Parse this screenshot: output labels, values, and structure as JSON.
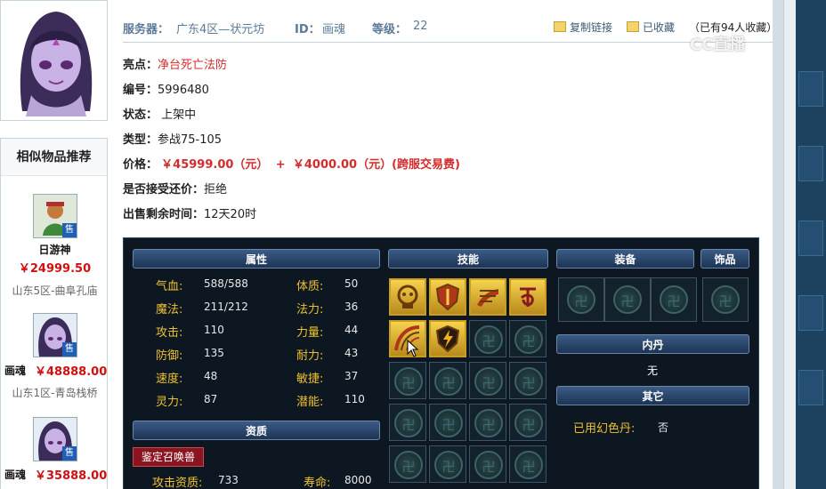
{
  "header": {
    "server_label": "服务器：",
    "server_value": "广东4区—状元坊",
    "id_label": "ID：",
    "id_value": "画魂",
    "level_label": "等级：",
    "level_value": "22",
    "copy_link": "复制链接",
    "favorited": "已收藏",
    "collect_count": "（已有94人收藏）"
  },
  "info": {
    "highlight_key": "亮点：",
    "highlight_val": "净台死亡法防",
    "serial_key": "编号：",
    "serial_val": "5996480",
    "status_key": "状态：",
    "status_val": "上架中",
    "type_key": "类型：",
    "type_val": "参战75-105",
    "price_key": "价格：",
    "price_val": "￥45999.00（元）",
    "plus": "+",
    "fee_val": "￥4000.00（元）(跨服交易费)",
    "counter_key": "是否接受还价：",
    "counter_val": "拒绝",
    "remain_key": "出售剩余时间：",
    "remain_val": "12天20时"
  },
  "recommend": {
    "title": "相似物品推荐",
    "sold_tag": "售",
    "items": [
      {
        "name": "日游神",
        "price": "￥24999.50",
        "server": "山东5区-曲阜孔庙",
        "icon": "day-wanderer-icon"
      },
      {
        "name": "画魂",
        "price": "￥48888.00",
        "server": "山东1区-青岛栈桥",
        "icon": "hua-hun-icon"
      },
      {
        "name": "画魂",
        "price": "￥35888.00",
        "server": "",
        "icon": "hua-hun-icon"
      }
    ]
  },
  "game": {
    "attr_title": "属性",
    "skill_title": "技能",
    "equip_title": "装备",
    "accessory_title": "饰品",
    "neidan_title": "内丹",
    "neidan_val": "无",
    "other_title": "其它",
    "qual_title": "资质",
    "appraise_btn": "鉴定召唤兽",
    "attrs_left": [
      {
        "k": "气血:",
        "v": "588/588"
      },
      {
        "k": "魔法:",
        "v": "211/212"
      },
      {
        "k": "攻击:",
        "v": "110"
      },
      {
        "k": "防御:",
        "v": "135"
      },
      {
        "k": "速度:",
        "v": "48"
      },
      {
        "k": "灵力:",
        "v": "87"
      }
    ],
    "attrs_right": [
      {
        "k": "体质:",
        "v": "50"
      },
      {
        "k": "法力:",
        "v": "36"
      },
      {
        "k": "力量:",
        "v": "44"
      },
      {
        "k": "耐力:",
        "v": "43"
      },
      {
        "k": "敏捷:",
        "v": "37"
      },
      {
        "k": "潜能:",
        "v": "110"
      }
    ],
    "qual_left_k": "攻击资质:",
    "qual_left_v": "733",
    "qual_right_k": "寿命:",
    "qual_right_v": "8000",
    "used_pill_k": "已用幻色丹:",
    "used_pill_v": "否",
    "skills": [
      "dead-skull-icon",
      "shield-defense-icon",
      "scroll-magic-icon",
      "rune-glyph-icon",
      "arc-slash-icon",
      "lightning-shield-icon"
    ]
  },
  "watermark": "CC直播"
}
